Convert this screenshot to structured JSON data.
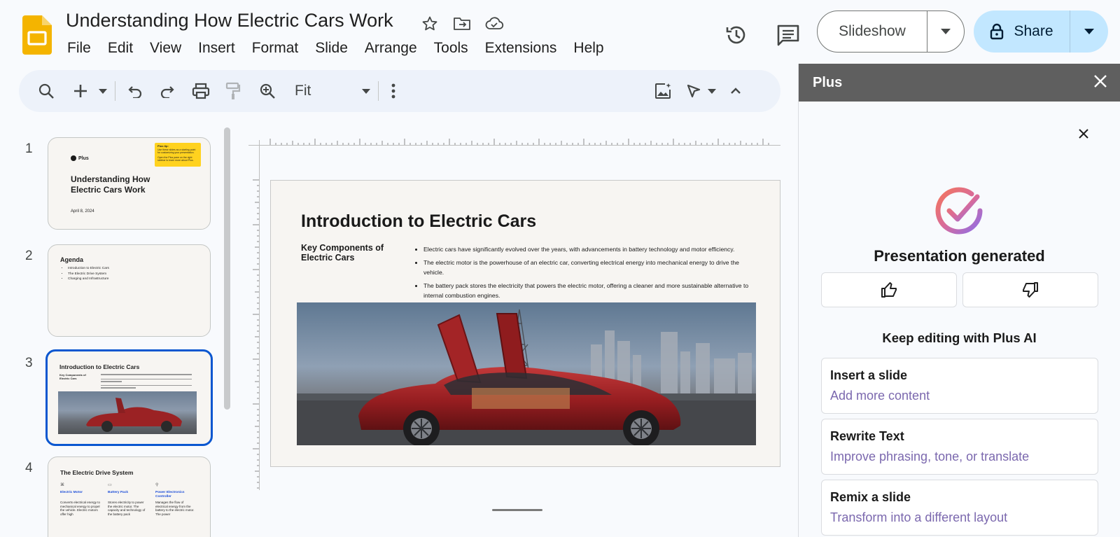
{
  "app": {
    "doc_title": "Understanding How Electric Cars Work"
  },
  "menu": [
    "File",
    "Edit",
    "View",
    "Insert",
    "Format",
    "Slide",
    "Arrange",
    "Tools",
    "Extensions",
    "Help"
  ],
  "header": {
    "slideshow_label": "Slideshow",
    "share_label": "Share",
    "share_color": "#c2e7ff"
  },
  "toolbar": {
    "zoom_label": "Fit"
  },
  "filmstrip": {
    "slides": [
      {
        "number": "1",
        "badge": "Plus",
        "title": "Understanding How Electric Cars Work",
        "date": "April 8, 2024",
        "tip_title": "Plus tip:",
        "tip_line1": "Use these slides as a starting point for customizing your presentation.",
        "tip_line2": "Open the Plus pane on the right sidebar to learn more about Plus."
      },
      {
        "number": "2",
        "title": "Agenda",
        "items": [
          "Introduction to Electric Cars",
          "The Electric Drive System",
          "Charging and Infrastructure"
        ]
      },
      {
        "number": "3",
        "title": "Introduction to Electric Cars",
        "subtitle": "Key Components of Electric Cars"
      },
      {
        "number": "4",
        "title": "The Electric Drive System",
        "cols": [
          {
            "heading": "Electric Motor",
            "text": "Converts electrical energy to mechanical energy to propel the vehicle. Electric motors offer high"
          },
          {
            "heading": "Battery Pack",
            "text": "Stores electricity to power the electric motor. The capacity and technology of the battery pack"
          },
          {
            "heading": "Power Electronics Controller",
            "text": "Manages the flow of electrical energy from the battery to the electric motor. The power"
          }
        ]
      }
    ]
  },
  "slide": {
    "title": "Introduction to Electric Cars",
    "subtitle": "Key Components of Electric Cars",
    "bullets": [
      "Electric cars have significantly evolved over the years, with advancements in battery technology and motor efficiency.",
      "The electric motor is the powerhouse of an electric car, converting electrical energy into mechanical energy to drive the vehicle.",
      "The battery pack stores the electricity that powers the electric motor, offering a cleaner and more sustainable alternative to internal combustion engines."
    ]
  },
  "panel": {
    "title": "Plus",
    "status": "Presentation generated",
    "keep_editing": "Keep editing with Plus AI",
    "actions": [
      {
        "title": "Insert a slide",
        "desc": "Add more content"
      },
      {
        "title": "Rewrite Text",
        "desc": "Improve phrasing, tone, or translate"
      },
      {
        "title": "Remix a slide",
        "desc": "Transform into a different layout"
      }
    ],
    "accent_color": "#7b68ae"
  }
}
